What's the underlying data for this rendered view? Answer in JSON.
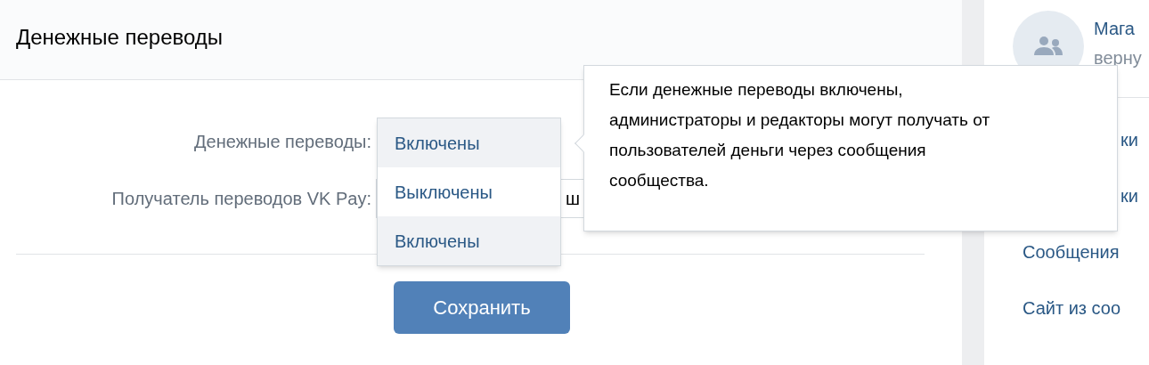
{
  "header": {
    "title": "Денежные переводы"
  },
  "form": {
    "fields": [
      {
        "label": "Денежные переводы:"
      },
      {
        "label": "Получатель переводов VK Pay:",
        "value": "ш"
      }
    ]
  },
  "dropdown": {
    "options": [
      {
        "label": "Включены",
        "highlighted": true
      },
      {
        "label": "Выключены",
        "highlighted": false
      },
      {
        "label": "Включены",
        "highlighted": true
      }
    ]
  },
  "save_button": "Сохранить",
  "tooltip": {
    "text": "Если денежные переводы включены, администраторы и редакторы могут получать от пользователей деньги через сообщения сообщества."
  },
  "sidebar": {
    "group": {
      "name": "Мага",
      "subtitle": "верну"
    },
    "menu": [
      {
        "label": "ки",
        "covered": true
      },
      {
        "label": "ки",
        "covered": true
      },
      {
        "label": "Сообщения",
        "covered": false
      },
      {
        "label": "Сайт из соо",
        "covered": false
      }
    ]
  }
}
